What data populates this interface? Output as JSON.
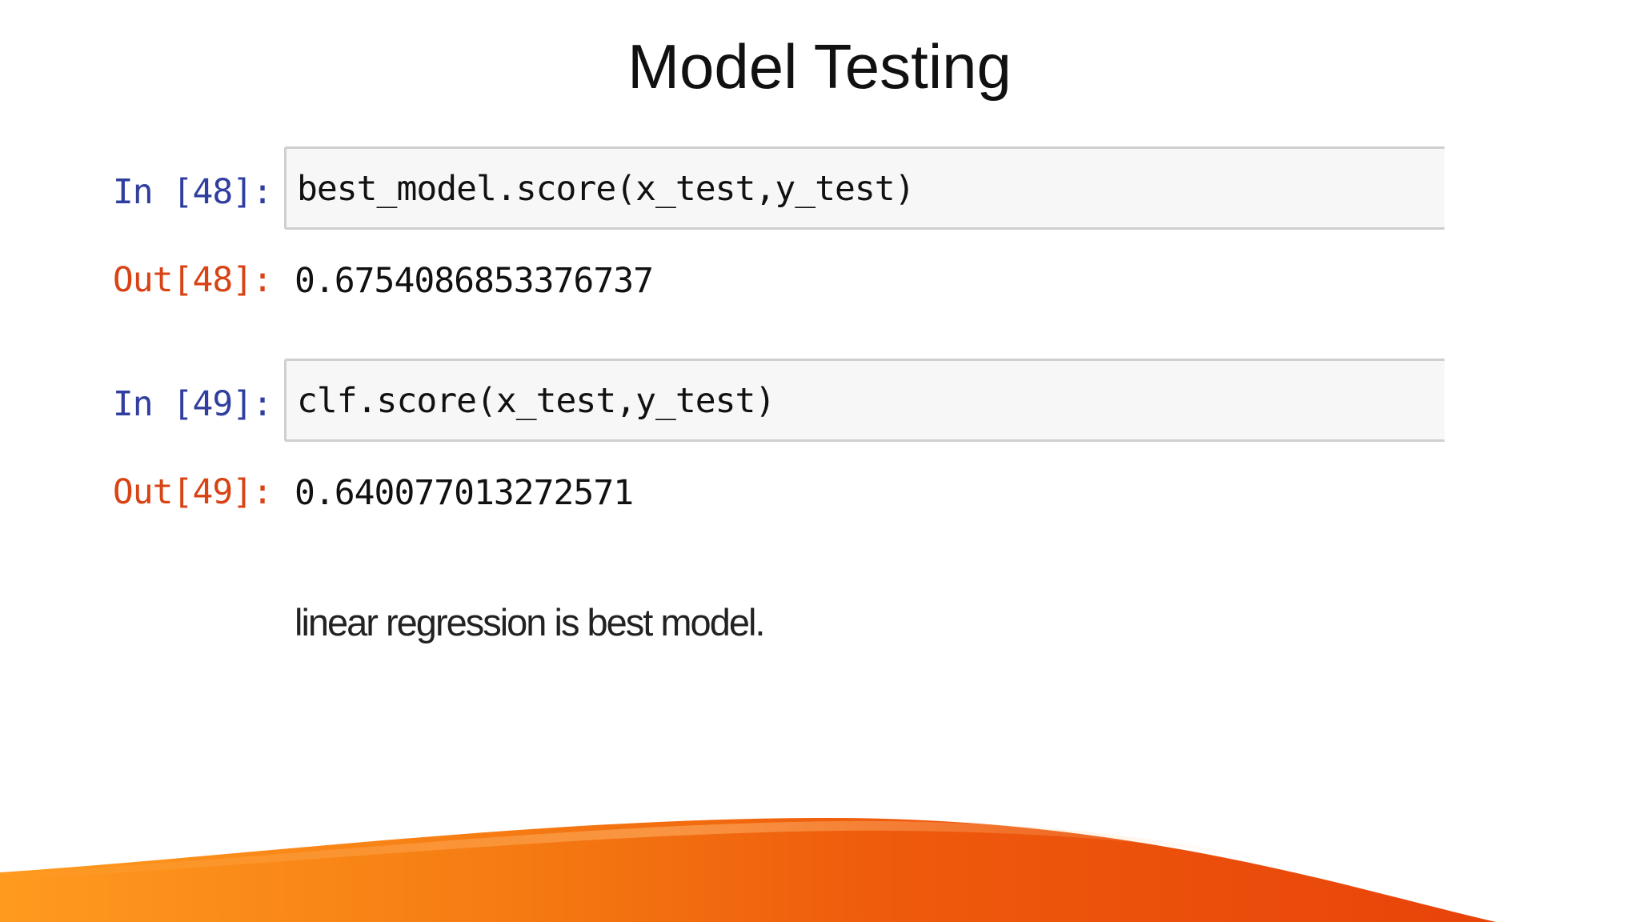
{
  "slide": {
    "title": "Model Testing"
  },
  "cells": [
    {
      "in_prompt": "In [48]:",
      "code": "best_model.score(x_test,y_test)",
      "out_prompt": "Out[48]:",
      "output": "0.6754086853376737"
    },
    {
      "in_prompt": "In [49]:",
      "code": "clf.score(x_test,y_test)",
      "out_prompt": "Out[49]:",
      "output": "0.640077013272571"
    }
  ],
  "markdown": {
    "text": "linear regression is best model."
  },
  "colors": {
    "in_prompt": "#303f9f",
    "out_prompt": "#d84315",
    "cell_background": "#f7f7f7",
    "cell_border": "#cfcfcf",
    "wave_dark": "#e8430a",
    "wave_light": "#ff9a1f"
  }
}
